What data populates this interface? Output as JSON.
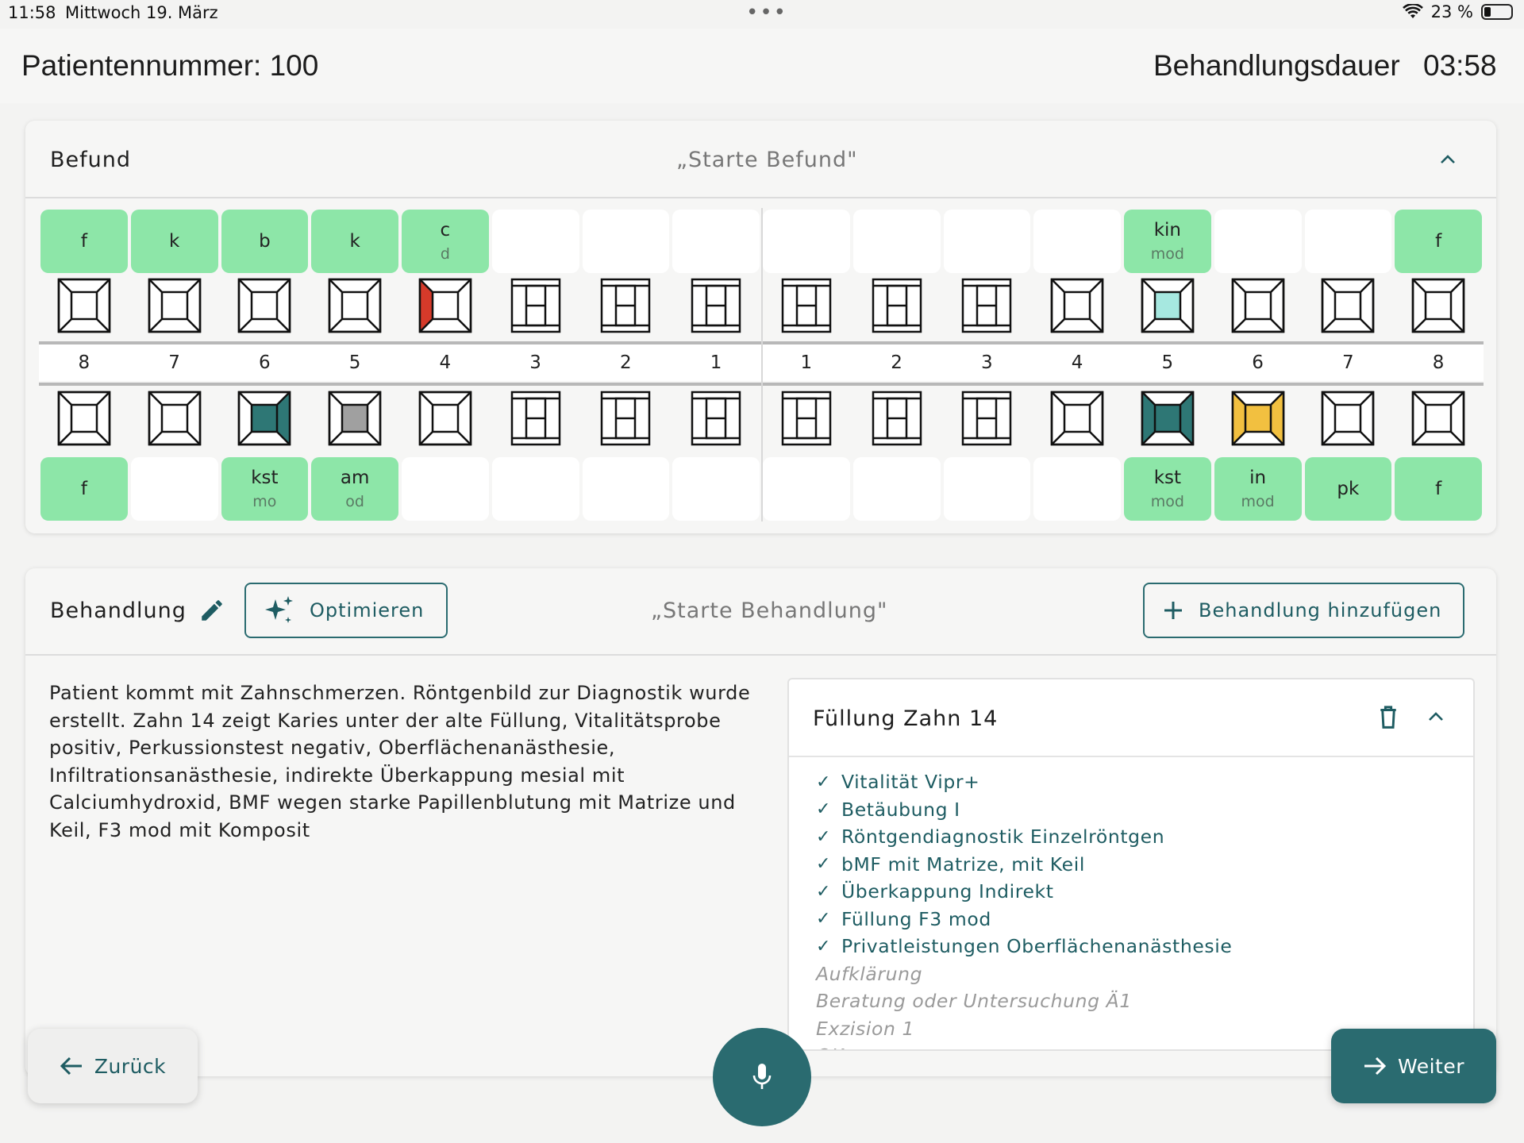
{
  "status": {
    "time": "11:58",
    "date": "Mittwoch 19. März",
    "battery": "23 %"
  },
  "header": {
    "patient": "Patientennummer: 100",
    "duration_label": "Behandlungsdauer",
    "duration_value": "03:58"
  },
  "befund": {
    "title": "Befund",
    "hint": "„Starte Befund\"",
    "upper_labels": [
      {
        "m": "f",
        "s": "",
        "on": true
      },
      {
        "m": "k",
        "s": "",
        "on": true
      },
      {
        "m": "b",
        "s": "",
        "on": true
      },
      {
        "m": "k",
        "s": "",
        "on": true
      },
      {
        "m": "c",
        "s": "d",
        "on": true
      },
      {
        "m": "",
        "s": "",
        "on": false
      },
      {
        "m": "",
        "s": "",
        "on": false
      },
      {
        "m": "",
        "s": "",
        "on": false
      },
      {
        "m": "",
        "s": "",
        "on": false
      },
      {
        "m": "",
        "s": "",
        "on": false
      },
      {
        "m": "",
        "s": "",
        "on": false
      },
      {
        "m": "",
        "s": "",
        "on": false
      },
      {
        "m": "kin",
        "s": "mod",
        "on": true
      },
      {
        "m": "",
        "s": "",
        "on": false
      },
      {
        "m": "",
        "s": "",
        "on": false
      },
      {
        "m": "f",
        "s": "",
        "on": true
      }
    ],
    "upper_teeth": [
      {
        "kind": "molar"
      },
      {
        "kind": "molar"
      },
      {
        "kind": "molar"
      },
      {
        "kind": "molar"
      },
      {
        "kind": "molar",
        "left": "#d63a2a"
      },
      {
        "kind": "front"
      },
      {
        "kind": "front"
      },
      {
        "kind": "front"
      },
      {
        "kind": "front"
      },
      {
        "kind": "front"
      },
      {
        "kind": "front"
      },
      {
        "kind": "molar"
      },
      {
        "kind": "molar",
        "center": "#a6e8e0"
      },
      {
        "kind": "molar"
      },
      {
        "kind": "molar"
      },
      {
        "kind": "molar"
      }
    ],
    "numbers": [
      "8",
      "7",
      "6",
      "5",
      "4",
      "3",
      "2",
      "1",
      "1",
      "2",
      "3",
      "4",
      "5",
      "6",
      "7",
      "8"
    ],
    "lower_teeth": [
      {
        "kind": "molar"
      },
      {
        "kind": "molar"
      },
      {
        "kind": "molar",
        "center": "#2e7775",
        "right": "#2e7775"
      },
      {
        "kind": "molar",
        "center": "#a0a0a0"
      },
      {
        "kind": "molar"
      },
      {
        "kind": "front"
      },
      {
        "kind": "front"
      },
      {
        "kind": "front"
      },
      {
        "kind": "front"
      },
      {
        "kind": "front"
      },
      {
        "kind": "front"
      },
      {
        "kind": "molar"
      },
      {
        "kind": "molar",
        "center": "#2e7775",
        "left": "#2e7775",
        "right": "#2e7775"
      },
      {
        "kind": "molar",
        "center": "#f2c040",
        "left": "#f2c040",
        "right": "#f2c040"
      },
      {
        "kind": "molar"
      },
      {
        "kind": "molar"
      }
    ],
    "lower_labels": [
      {
        "m": "f",
        "s": "",
        "on": true
      },
      {
        "m": "",
        "s": "",
        "on": false
      },
      {
        "m": "kst",
        "s": "mo",
        "on": true
      },
      {
        "m": "am",
        "s": "od",
        "on": true
      },
      {
        "m": "",
        "s": "",
        "on": false
      },
      {
        "m": "",
        "s": "",
        "on": false
      },
      {
        "m": "",
        "s": "",
        "on": false
      },
      {
        "m": "",
        "s": "",
        "on": false
      },
      {
        "m": "",
        "s": "",
        "on": false
      },
      {
        "m": "",
        "s": "",
        "on": false
      },
      {
        "m": "",
        "s": "",
        "on": false
      },
      {
        "m": "",
        "s": "",
        "on": false
      },
      {
        "m": "kst",
        "s": "mod",
        "on": true
      },
      {
        "m": "in",
        "s": "mod",
        "on": true
      },
      {
        "m": "pk",
        "s": "",
        "on": true
      },
      {
        "m": "f",
        "s": "",
        "on": true
      }
    ]
  },
  "behandlung": {
    "title": "Behandlung",
    "optimize_label": "Optimieren",
    "hint": "„Starte Behandlung\"",
    "add_label": "Behandlung hinzufügen",
    "notes": "Patient kommt mit Zahnschmerzen. Röntgenbild zur Diagnostik wurde erstellt. Zahn 14 zeigt Karies unter der alte Füllung, Vitalitätsprobe positiv, Perkussionstest negativ, Oberflächenanästhesie, Infiltrationsanästhesie, indirekte Überkappung mesial mit Calciumhydroxid, BMF wegen starke Papillenblutung mit Matrize und Keil, F3 mod mit Komposit",
    "panel_title": "Füllung Zahn 14",
    "items": [
      {
        "label": "Vitalität Vipr+",
        "checked": true
      },
      {
        "label": "Betäubung I",
        "checked": true
      },
      {
        "label": "Röntgendiagnostik Einzelröntgen",
        "checked": true
      },
      {
        "label": "bMF mit Matrize, mit Keil",
        "checked": true
      },
      {
        "label": "Überkappung Indirekt",
        "checked": true
      },
      {
        "label": "Füllung F3 mod",
        "checked": true
      },
      {
        "label": "Privatleistungen Oberflächenanästhesie",
        "checked": true
      },
      {
        "label": "Aufklärung",
        "checked": false
      },
      {
        "label": "Beratung oder Untersuchung Ä1",
        "checked": false
      },
      {
        "label": "Exzision 1",
        "checked": false
      },
      {
        "label": "OK",
        "checked": false
      }
    ]
  },
  "footer": {
    "back_label": "Zurück",
    "next_label": "Weiter"
  },
  "colors": {
    "accent": "#2a6b70",
    "chip_on": "#8de6a8"
  }
}
